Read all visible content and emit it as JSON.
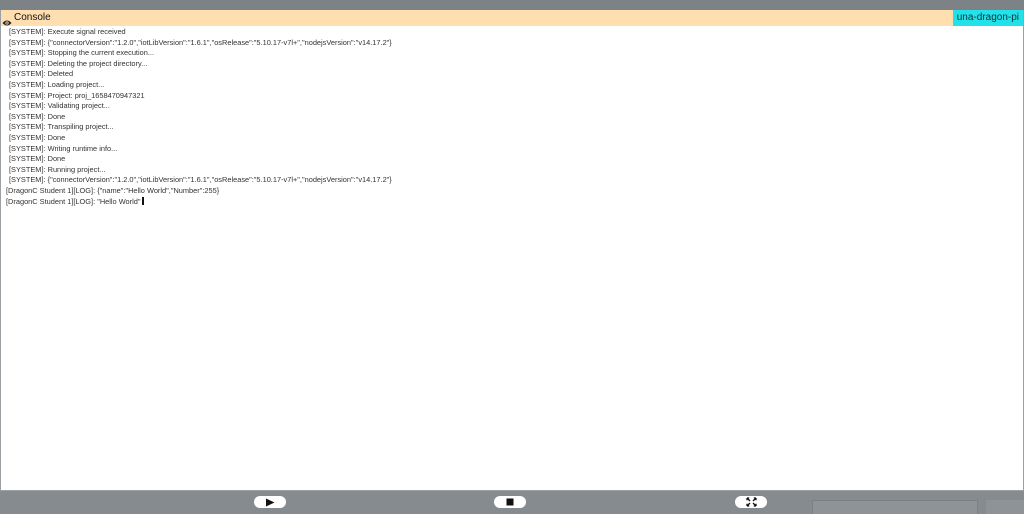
{
  "background": {
    "top_ghost_text": "",
    "bottom_left_ghost_text": "",
    "bottom_right_ghost_text": ""
  },
  "console": {
    "title": "Console",
    "device": "una-dragon-pi",
    "icon": "eye-icon",
    "header_color": "#ffdeb0",
    "badge_color": "#23e1e9",
    "lines": [
      {
        "text": "[SYSTEM]: Execute signal received",
        "kind": "system"
      },
      {
        "text": "[SYSTEM]: {\"connectorVersion\":\"1.2.0\",\"iotLibVersion\":\"1.6.1\",\"osRelease\":\"5.10.17-v7l+\",\"nodejsVersion\":\"v14.17.2\"}",
        "kind": "system"
      },
      {
        "text": "[SYSTEM]: Stopping the current execution...",
        "kind": "system"
      },
      {
        "text": "[SYSTEM]: Deleting the project directory...",
        "kind": "system"
      },
      {
        "text": "[SYSTEM]: Deleted",
        "kind": "system"
      },
      {
        "text": "[SYSTEM]: Loading project...",
        "kind": "system"
      },
      {
        "text": "[SYSTEM]: Project: proj_1658470947321",
        "kind": "system"
      },
      {
        "text": "[SYSTEM]: Validating project...",
        "kind": "system"
      },
      {
        "text": "[SYSTEM]: Done",
        "kind": "system"
      },
      {
        "text": "[SYSTEM]: Transpiling project...",
        "kind": "system"
      },
      {
        "text": "[SYSTEM]: Done",
        "kind": "system"
      },
      {
        "text": "[SYSTEM]: Writing runtime info...",
        "kind": "system"
      },
      {
        "text": "[SYSTEM]: Done",
        "kind": "system"
      },
      {
        "text": "[SYSTEM]: Running project...",
        "kind": "system"
      },
      {
        "text": "[SYSTEM]: {\"connectorVersion\":\"1.2.0\",\"iotLibVersion\":\"1.6.1\",\"osRelease\":\"5.10.17-v7l+\",\"nodejsVersion\":\"v14.17.2\"}",
        "kind": "system"
      },
      {
        "text": "[DragonC Student 1][LOG]: {\"name\":\"Hello World\",\"Number\":255}",
        "kind": "user"
      },
      {
        "text": "[DragonC Student 1][LOG]: \"Hello World\"",
        "kind": "user"
      }
    ]
  },
  "controls": {
    "play_icon": "play-icon",
    "stop_icon": "stop-icon",
    "expand_icon": "expand-icon"
  }
}
